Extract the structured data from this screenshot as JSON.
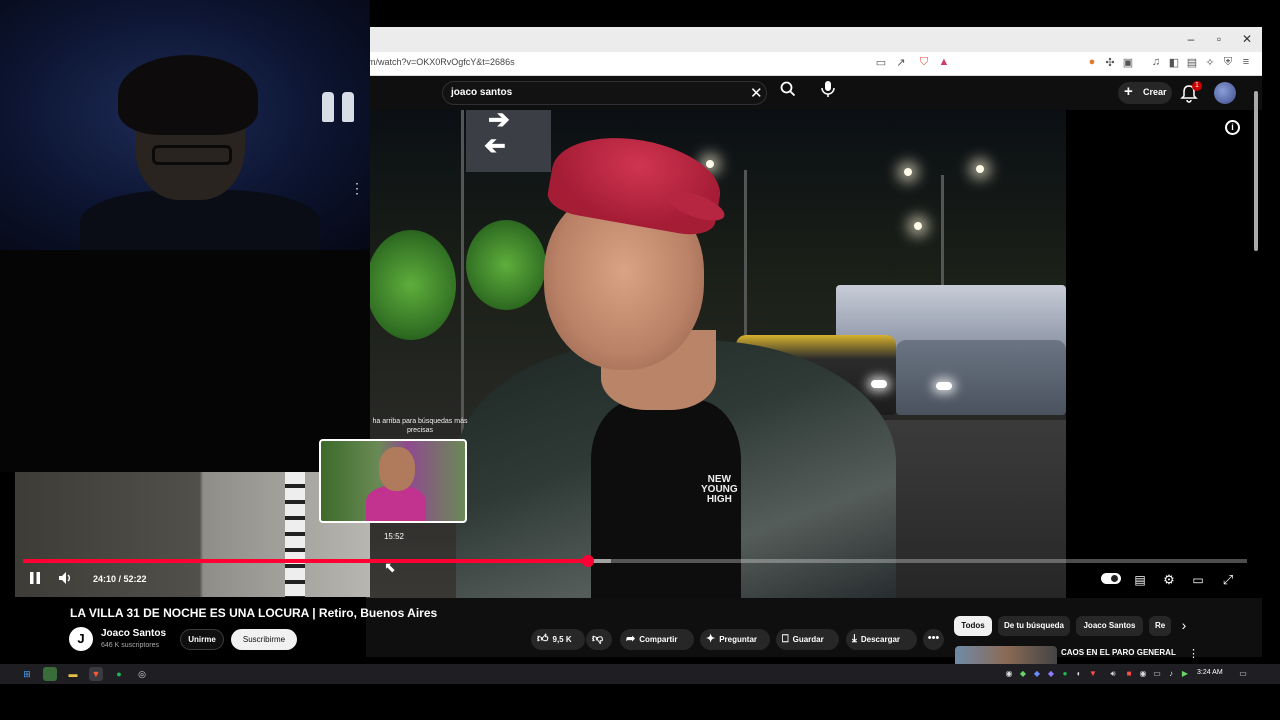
{
  "browser": {
    "url": "m/watch?v=OKX0RvOgfcY&t=2686s",
    "window_controls": [
      "–",
      "▫",
      "✕"
    ]
  },
  "youtube": {
    "search": {
      "value": "joaco santos",
      "clear_glyph": "✕"
    },
    "create_label": "Crear",
    "notification_count": "1"
  },
  "video": {
    "brand_text": [
      "NEW",
      "YOUNG",
      "HIGH"
    ],
    "preview": {
      "tip": "Desliza hacia arriba para búsquedas más precisas",
      "tip_visible": "ha arriba para búsquedas más precisas",
      "time": "15:52"
    },
    "progress": {
      "played_fraction": 0.462,
      "buffered_fraction": 0.48
    },
    "time_display": "24:10 / 52:22",
    "title": "LA VILLA 31 DE NOCHE ES UNA LOCURA | Retiro, Buenos Aires"
  },
  "channel": {
    "avatar_letter": "J",
    "name": "Joaco Santos",
    "subscribers": "646 K suscriptores",
    "join_label": "Unirme",
    "subscribe_label": "Suscribirme"
  },
  "actions": {
    "likes": "9,5 K",
    "share": "Compartir",
    "ask": "Preguntar",
    "save": "Guardar",
    "download": "Descargar",
    "more": "•••"
  },
  "chips": [
    "Todos",
    "De tu búsqueda",
    "Joaco Santos",
    "Re"
  ],
  "recommendation": {
    "title": "CAOS EN EL PARO GENERAL"
  },
  "taskbar": {
    "clock": "3:24 AM"
  },
  "icons": {
    "accent": "#ff0033",
    "search": "search-icon",
    "mic": "mic-icon",
    "bell": "bell-icon"
  }
}
